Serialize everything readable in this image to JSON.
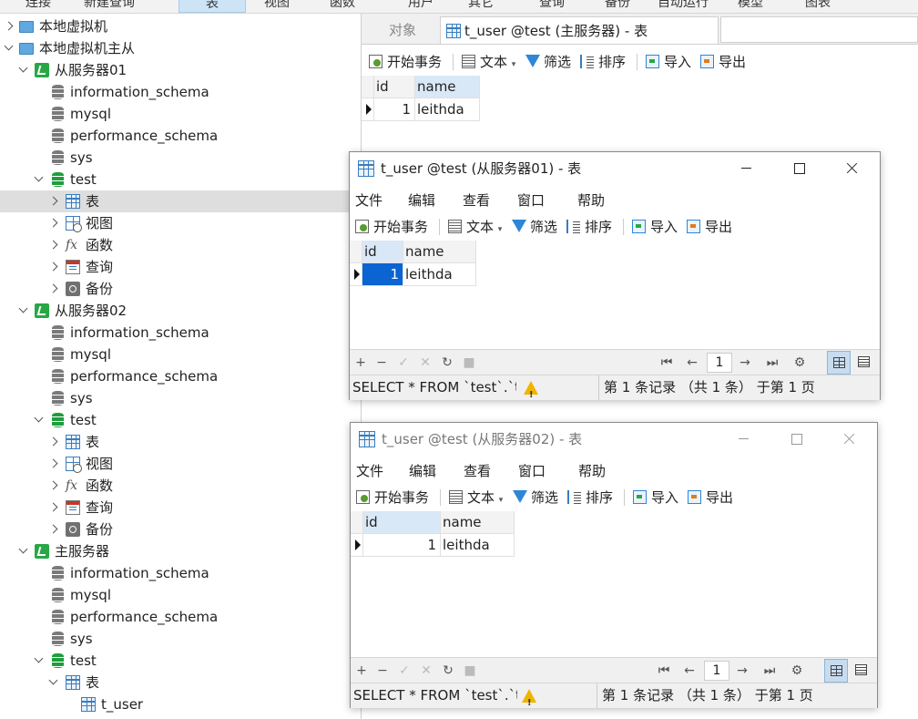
{
  "toolbar": {
    "items": [
      "连接",
      "新建查询",
      "表",
      "视图",
      "函数",
      "用户",
      "其它",
      "查询",
      "备份",
      "自动运行",
      "模型",
      "图表"
    ]
  },
  "tree": {
    "rows": [
      {
        "label": "本地虚拟机"
      },
      {
        "label": "本地虚拟机主从"
      },
      {
        "label": "从服务器01"
      },
      {
        "label": "information_schema"
      },
      {
        "label": "mysql"
      },
      {
        "label": "performance_schema"
      },
      {
        "label": "sys"
      },
      {
        "label": "test"
      },
      {
        "label": "表"
      },
      {
        "label": "视图"
      },
      {
        "label": "函数"
      },
      {
        "label": "查询"
      },
      {
        "label": "备份"
      },
      {
        "label": "从服务器02"
      },
      {
        "label": "information_schema"
      },
      {
        "label": "mysql"
      },
      {
        "label": "performance_schema"
      },
      {
        "label": "sys"
      },
      {
        "label": "test"
      },
      {
        "label": "表"
      },
      {
        "label": "视图"
      },
      {
        "label": "函数"
      },
      {
        "label": "查询"
      },
      {
        "label": "备份"
      },
      {
        "label": "主服务器"
      },
      {
        "label": "information_schema"
      },
      {
        "label": "mysql"
      },
      {
        "label": "performance_schema"
      },
      {
        "label": "sys"
      },
      {
        "label": "test"
      },
      {
        "label": "表"
      },
      {
        "label": "t_user"
      }
    ]
  },
  "main": {
    "tabs": {
      "objects": "对象",
      "active": "t_user @test (主服务器) - 表"
    },
    "grid": {
      "columns": [
        "id",
        "name"
      ],
      "rows": [
        [
          "1",
          "leithda"
        ]
      ]
    }
  },
  "table_toolbar": {
    "begin": "开始事务",
    "text": "文本",
    "filter": "筛选",
    "sort": "排序",
    "import": "导入",
    "export": "导出"
  },
  "menu": {
    "file": "文件",
    "edit": "编辑",
    "view": "查看",
    "window": "窗口",
    "help": "帮助"
  },
  "windows": [
    {
      "title": "t_user @test (从服务器01) - 表",
      "grid": {
        "columns": [
          "id",
          "name"
        ],
        "rows": [
          [
            "1",
            "leithda"
          ]
        ]
      },
      "page": "1",
      "sql": "SELECT * FROM `test`.`t_user`",
      "records": "第 1 条记录 （共 1 条） 于第 1 页"
    },
    {
      "title": "t_user @test (从服务器02) - 表",
      "grid": {
        "columns": [
          "id",
          "name"
        ],
        "rows": [
          [
            "1",
            "leithda"
          ]
        ]
      },
      "page": "1",
      "sql": "SELECT * FROM `test`.`t_user`",
      "records": "第 1 条记录 （共 1 条） 于第 1 页"
    }
  ],
  "colors": {
    "selection": "#0a64d2",
    "connection": "#28a745",
    "tree_selected": "#dedede"
  }
}
